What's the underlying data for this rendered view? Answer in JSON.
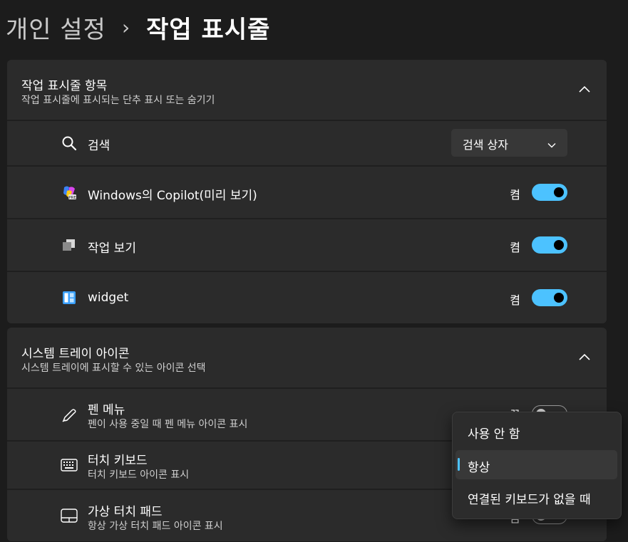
{
  "breadcrumb": {
    "parent": "개인 설정",
    "separator": "›",
    "current": "작업 표시줄"
  },
  "taskbar_items": {
    "title": "작업 표시줄 항목",
    "subtitle": "작업 표시줄에 표시되는 단추 표시 또는 숨기기",
    "search": {
      "label": "검색",
      "value": "검색 상자"
    },
    "rows": [
      {
        "label": "Windows의 Copilot(미리 보기)",
        "state": "켬",
        "on": true
      },
      {
        "label": "작업 보기",
        "state": "켬",
        "on": true
      },
      {
        "label": "widget",
        "state": "켬",
        "on": true
      }
    ]
  },
  "system_tray": {
    "title": "시스템 트레이 아이콘",
    "subtitle": "시스템 트레이에 표시할 수 있는 아이콘 선택",
    "rows": [
      {
        "label": "펜 메뉴",
        "desc": "펜이 사용 중일 때 펜 메뉴 아이콘 표시",
        "state": "끔"
      },
      {
        "label": "터치 키보드",
        "desc": "터치 키보드 아이콘 표시"
      },
      {
        "label": "가상 터치 패드",
        "desc": "항상 가상 터치 패드 아이콘 표시",
        "state": "끔"
      }
    ]
  },
  "dropdown_menu": {
    "options": [
      "사용 안 함",
      "항상",
      "연결된 키보드가 없을 때"
    ],
    "selected": "항상"
  },
  "colors": {
    "accent": "#4cc2ff",
    "background": "#1c1c1c",
    "card": "#2b2b2b"
  },
  "icons": {
    "search": "search-icon",
    "copilot": "copilot-icon",
    "taskview": "task-view-icon",
    "widgets": "widgets-icon",
    "pen": "pen-icon",
    "keyboard": "keyboard-icon",
    "touchpad": "touchpad-icon",
    "chevron_up": "chevron-up-icon",
    "chevron_down": "chevron-down-icon"
  }
}
